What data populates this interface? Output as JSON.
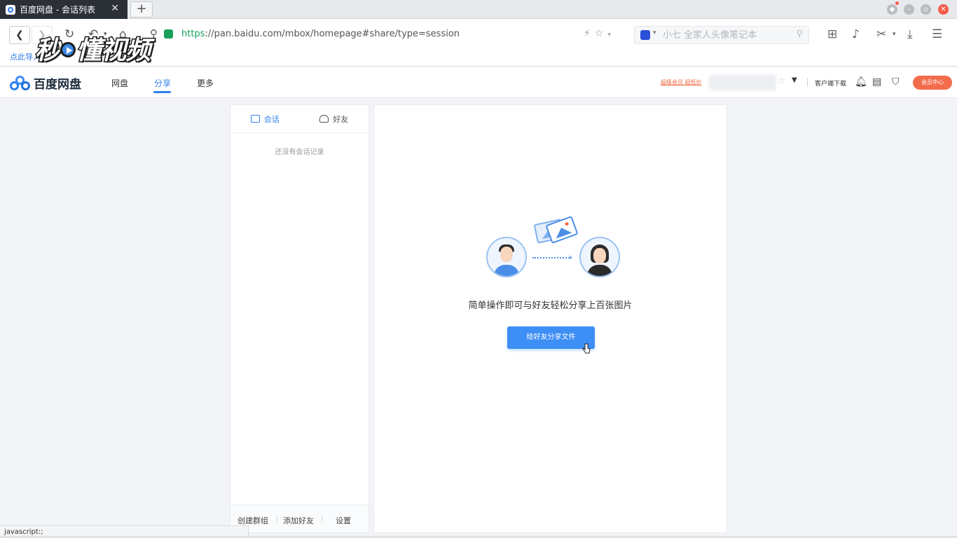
{
  "browser": {
    "tab_title": "百度网盘 - 会话列表",
    "tab_close": "✕",
    "new_tab": "+",
    "url_scheme": "https",
    "url_rest": "://pan.baidu.com/mbox/homepage#share/type=session",
    "search_placeholder": "小七 全家人头像笔记本",
    "bookmark_hint": "点此导入",
    "watermark": "秒懂视频",
    "status_text": "javascript:;"
  },
  "site": {
    "logo_text": "百度网盘",
    "nav": [
      {
        "label": "网盘"
      },
      {
        "label": "分享"
      },
      {
        "label": "更多"
      }
    ],
    "vip_link": "超级会员 超低价",
    "user_suffix": "3",
    "client_download": "客户端下载",
    "vip_center": "会员中心"
  },
  "sessions": {
    "tabs": [
      {
        "label": "会话"
      },
      {
        "label": "好友"
      }
    ],
    "empty_note": "还没有会话记录",
    "footer": [
      {
        "label": "创建群组"
      },
      {
        "label": "添加好友"
      },
      {
        "label": "设置"
      }
    ]
  },
  "main": {
    "tagline": "简单操作即可与好友轻松分享上百张图片",
    "share_button": "给好友分享文件"
  },
  "colors": {
    "accent": "#2f80ed",
    "vip": "#f36c4c",
    "button": "#3d8ef5"
  }
}
